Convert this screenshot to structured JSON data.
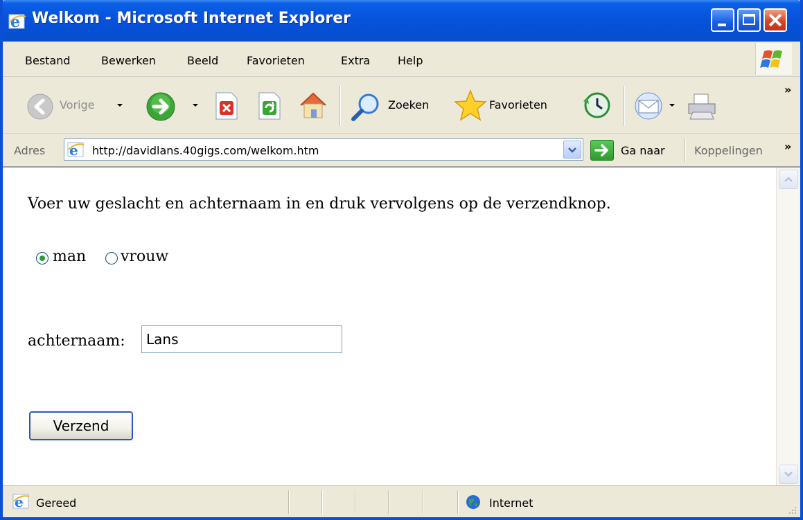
{
  "window": {
    "title": "Welkom - Microsoft Internet Explorer"
  },
  "menubar": {
    "items": [
      "Bestand",
      "Bewerken",
      "Beeld",
      "Favorieten",
      "Extra",
      "Help"
    ]
  },
  "toolbar": {
    "back_label": "Vorige",
    "search_label": "Zoeken",
    "favorites_label": "Favorieten",
    "icons": [
      "back-icon",
      "forward-icon",
      "stop-icon",
      "refresh-icon",
      "home-icon",
      "search-icon",
      "favorites-star-icon",
      "history-icon",
      "mail-icon",
      "print-icon"
    ]
  },
  "addressbar": {
    "label": "Adres",
    "url": "http://davidlans.40gigs.com/welkom.htm",
    "go_label": "Ga naar",
    "links_label": "Koppelingen"
  },
  "page": {
    "instruction": "Voer uw geslacht en achternaam in en druk vervolgens op de verzendknop.",
    "gender_options": [
      {
        "label": "man",
        "checked": true
      },
      {
        "label": "vrouw",
        "checked": false
      }
    ],
    "lastname_label": "achternaam:",
    "lastname_value": "Lans",
    "submit_label": "Verzend"
  },
  "statusbar": {
    "status": "Gereed",
    "zone": "Internet"
  },
  "colors": {
    "titlebar": "#0550d6",
    "chrome": "#ece9d8",
    "close_button": "#d8462a"
  }
}
